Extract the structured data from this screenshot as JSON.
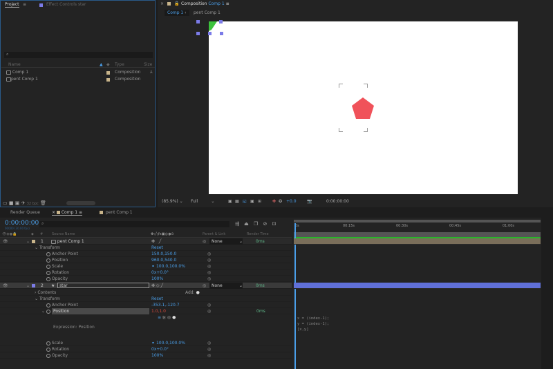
{
  "project": {
    "tab": "Project",
    "effect_tab": "Effect Controls star",
    "search_placeholder": "",
    "cols": {
      "name": "Name",
      "type": "Type",
      "size": "Size"
    },
    "items": [
      {
        "name": "Comp 1",
        "type": "Composition"
      },
      {
        "name": "pent Comp 1",
        "type": "Composition"
      }
    ],
    "bpc": "32 bpc"
  },
  "comp": {
    "title_prefix": "Composition",
    "title_name": "Comp 1",
    "crumbs": [
      "Comp 1",
      "pent Comp 1"
    ],
    "zoom": "(85.9%)",
    "resolution": "Full",
    "exposure": "+0.0",
    "timecode": "0:00:00:00",
    "colors": {
      "shape": "#f0525a",
      "canvas": "#ffffff"
    }
  },
  "tabs": {
    "render_queue": "Render Queue",
    "comp1": "Comp 1",
    "pent": "pent Comp 1"
  },
  "timeline": {
    "timecode": "0:00:00:00",
    "fps": "00000 (30.00 fps)",
    "cols": {
      "num": "#",
      "source": "Source Name",
      "parent": "Parent & Link",
      "render": "Render Time"
    },
    "ruler": [
      "0s",
      "00:15s",
      "00:30s",
      "00:45s",
      "01:00s"
    ],
    "layers": [
      {
        "num": "1",
        "name": "pent Comp 1",
        "parent": "None",
        "render": "0ms",
        "transform": "Transform",
        "reset": "Reset",
        "props": [
          {
            "name": "Anchor Point",
            "value": "150.0,150.0"
          },
          {
            "name": "Position",
            "value": "960.0,540.0"
          },
          {
            "name": "Scale",
            "value": "100.0,100.0%"
          },
          {
            "name": "Rotation",
            "value": "0x+0.0°"
          },
          {
            "name": "Opacity",
            "value": "100%"
          }
        ]
      },
      {
        "num": "2",
        "name": "star",
        "parent": "None",
        "render": "0ms",
        "contents": "Contents",
        "add": "Add:",
        "transform": "Transform",
        "reset": "Reset",
        "props": [
          {
            "name": "Anchor Point",
            "value": "-353.1,-120.7"
          },
          {
            "name": "Position",
            "value": "1.0,1.0",
            "render": "0ms"
          },
          {
            "name": "Scale",
            "value": "100.0,100.0%"
          },
          {
            "name": "Rotation",
            "value": "0x+0.0°"
          },
          {
            "name": "Opacity",
            "value": "100%"
          }
        ],
        "expression_label": "Expression: Position",
        "expression": [
          "x = (index-1);",
          "y = (index-1);",
          "[x,y]"
        ]
      }
    ]
  }
}
